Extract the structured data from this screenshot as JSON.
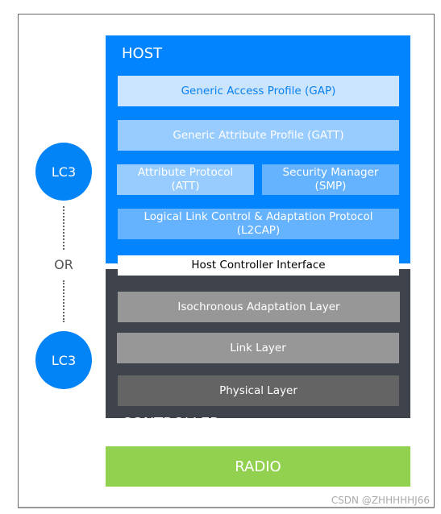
{
  "host": {
    "title": "HOST",
    "layers": {
      "gap": "Generic Access Profile (GAP)",
      "gatt": "Generic Attribute Profile (GATT)",
      "att": "Attribute Protocol (ATT)",
      "smp": "Security Manager (SMP)",
      "l2cap": "Logical Link Control & Adaptation Protocol (L2CAP)"
    }
  },
  "hci": "Host Controller Interface",
  "controller": {
    "title": "CONTROLLER",
    "layers": {
      "ial": "Isochronous Adaptation Layer",
      "link": "Link Layer",
      "phy": "Physical Layer"
    }
  },
  "radio": "RADIO",
  "codec": {
    "top": "LC3",
    "or": "OR",
    "bottom": "LC3"
  },
  "watermark": "CSDN @ZHHHHHJ66",
  "colors": {
    "host": "#0284fe",
    "controller": "#3f434b",
    "radio": "#92d050",
    "lc3": "#0384f6"
  }
}
